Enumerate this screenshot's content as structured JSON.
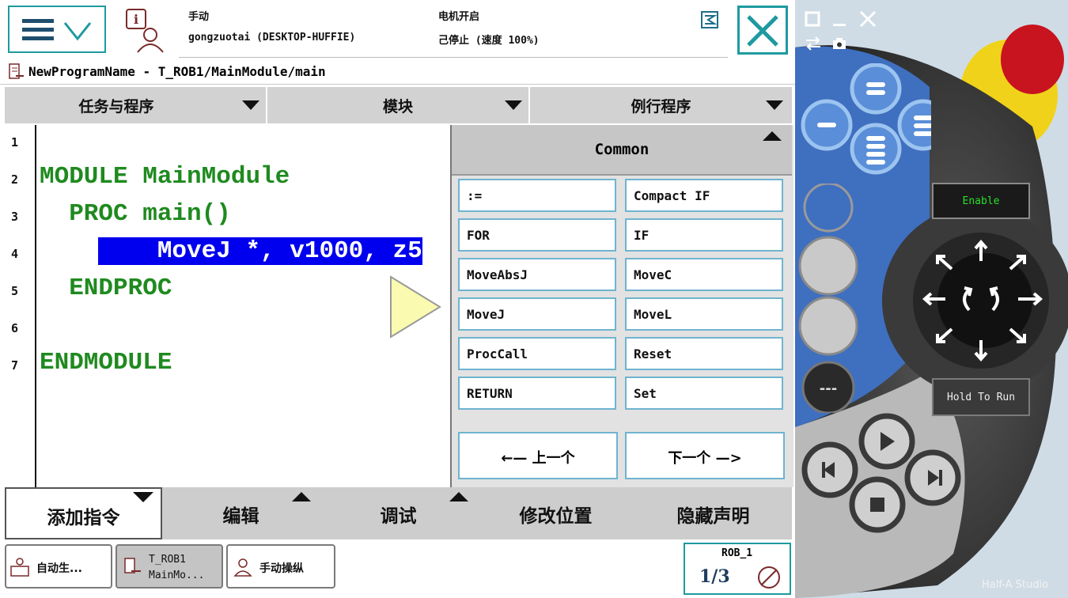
{
  "status": {
    "mode": "手动",
    "station": "gongzuotai (DESKTOP-HUFFIE)",
    "motor": "电机开启",
    "state": "己停止 (速度 100%)"
  },
  "path": "NewProgramName - T_ROB1/MainModule/main",
  "dropdowns": [
    "任务与程序",
    "模块",
    "例行程序"
  ],
  "code": {
    "line_numbers": [
      "1",
      "2",
      "3",
      "4",
      "5",
      "6",
      "7"
    ],
    "lines": [
      "",
      "MODULE MainModule",
      "  PROC main()",
      "    MoveJ *, v1000, z5",
      "  ENDPROC",
      "",
      "ENDMODULE"
    ]
  },
  "panel": {
    "title": "Common",
    "instructions": [
      ":=",
      "Compact IF",
      "FOR",
      "IF",
      "MoveAbsJ",
      "MoveC",
      "MoveJ",
      "MoveL",
      "ProcCall",
      "Reset",
      "RETURN",
      "Set"
    ],
    "prev": "←— 上一个",
    "next": "下一个 —>"
  },
  "bottom_tabs": [
    "添加指令",
    "编辑",
    "调试",
    "修改位置",
    "隐藏声明"
  ],
  "taskbar": {
    "items": [
      "自动生...",
      "T_ROB1",
      "MainMo...",
      "手动操纵"
    ],
    "robot": "ROB_1",
    "fraction": "1/3"
  },
  "pendant": {
    "enable": "Enable",
    "hold": "Hold To Run"
  },
  "watermark": "Half-A Studio",
  "colors": {
    "accent": "#1e9aa0",
    "code_green": "#1f8a1f",
    "highlight": "#0000ee"
  }
}
